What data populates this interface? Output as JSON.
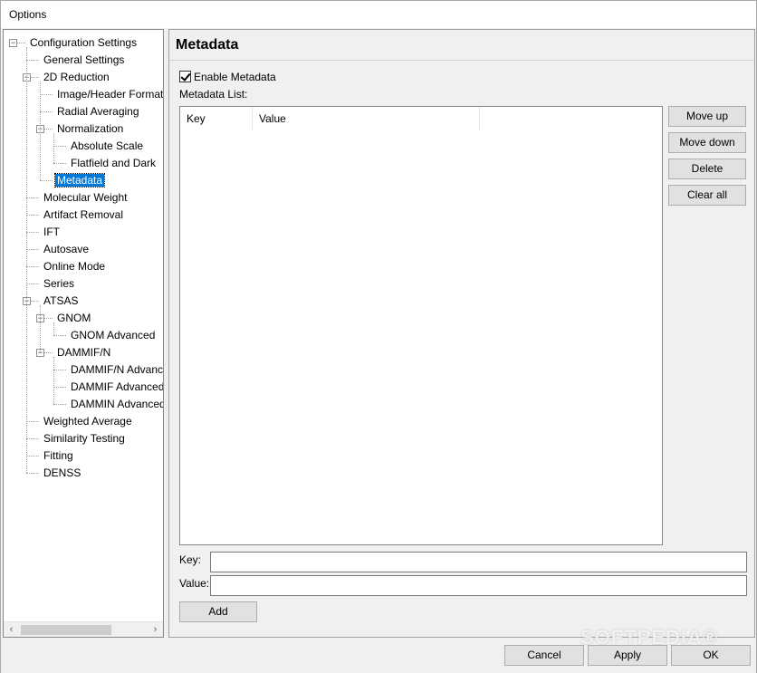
{
  "window": {
    "title": "Options"
  },
  "tree": {
    "items": [
      {
        "label": "Configuration Settings",
        "level": 0,
        "expander": "minus"
      },
      {
        "label": "General Settings",
        "level": 1
      },
      {
        "label": "2D Reduction",
        "level": 1,
        "expander": "minus"
      },
      {
        "label": "Image/Header Format",
        "level": 2
      },
      {
        "label": "Radial Averaging",
        "level": 2
      },
      {
        "label": "Normalization",
        "level": 2,
        "expander": "minus"
      },
      {
        "label": "Absolute Scale",
        "level": 3
      },
      {
        "label": "Flatfield and Dark",
        "level": 3
      },
      {
        "label": "Metadata",
        "level": 2,
        "selected": true
      },
      {
        "label": "Molecular Weight",
        "level": 1
      },
      {
        "label": "Artifact Removal",
        "level": 1
      },
      {
        "label": "IFT",
        "level": 1
      },
      {
        "label": "Autosave",
        "level": 1
      },
      {
        "label": "Online Mode",
        "level": 1
      },
      {
        "label": "Series",
        "level": 1
      },
      {
        "label": "ATSAS",
        "level": 1,
        "expander": "minus"
      },
      {
        "label": "GNOM",
        "level": 2,
        "expander": "minus"
      },
      {
        "label": "GNOM Advanced",
        "level": 3
      },
      {
        "label": "DAMMIF/N",
        "level": 2,
        "expander": "minus"
      },
      {
        "label": "DAMMIF/N Advanced",
        "level": 3
      },
      {
        "label": "DAMMIF Advanced",
        "level": 3
      },
      {
        "label": "DAMMIN Advanced",
        "level": 3
      },
      {
        "label": "Weighted Average",
        "level": 1
      },
      {
        "label": "Similarity Testing",
        "level": 1
      },
      {
        "label": "Fitting",
        "level": 1
      },
      {
        "label": "DENSS",
        "level": 1
      }
    ],
    "scroll_left_glyph": "‹",
    "scroll_right_glyph": "›"
  },
  "metadata_panel": {
    "title": "Metadata",
    "enable_label": "Enable Metadata",
    "enable_checked": true,
    "list_label": "Metadata List:",
    "columns": [
      "Key",
      "Value"
    ],
    "rows": [],
    "buttons": {
      "move_up": "Move up",
      "move_down": "Move down",
      "delete": "Delete",
      "clear_all": "Clear all"
    },
    "key_label": "Key:",
    "key_value": "",
    "value_label": "Value:",
    "value_value": "",
    "add_label": "Add"
  },
  "footer": {
    "cancel": "Cancel",
    "apply": "Apply",
    "ok": "OK"
  },
  "watermark": "SOFTPEDIA®"
}
